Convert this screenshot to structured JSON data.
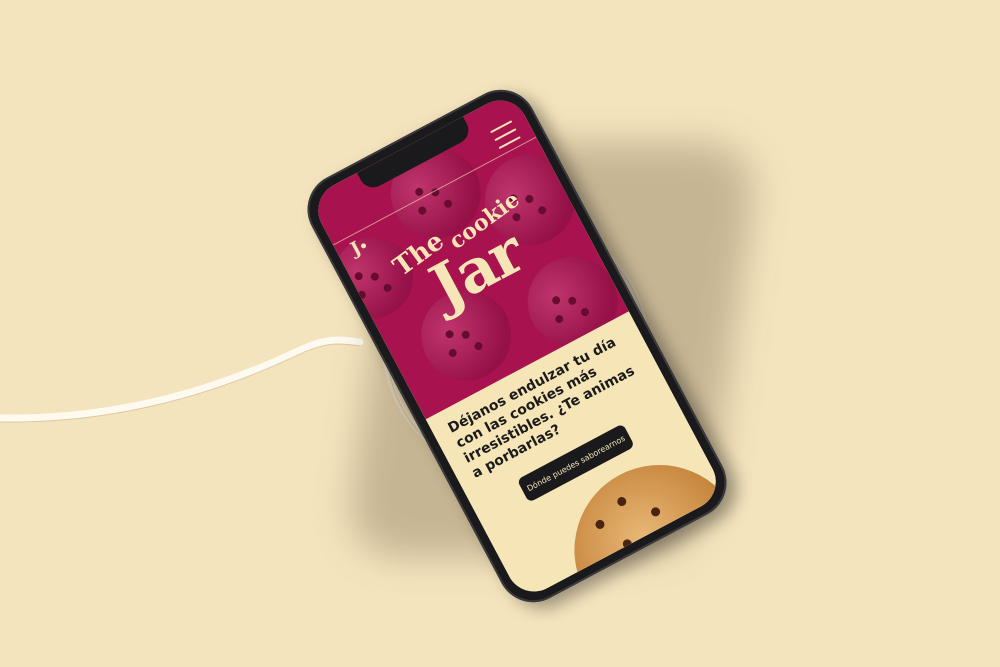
{
  "hero": {
    "logo": "J",
    "brand_the": "The",
    "brand_cookie": "cookie",
    "brand_jar": "Jar"
  },
  "content": {
    "headline": "Déjanos endulzar tu día con las cookies más irresistibles. ¿Te animas a porbarlas?",
    "cta_label": "Dónde puedes saborearnos"
  },
  "colors": {
    "background": "#f4e4bd",
    "brand": "#a8124f",
    "cream": "#f6e6b7",
    "dark": "#1a1a1c"
  },
  "icons": {
    "menu": "hamburger-menu-icon",
    "cookie": "cookie-image"
  }
}
